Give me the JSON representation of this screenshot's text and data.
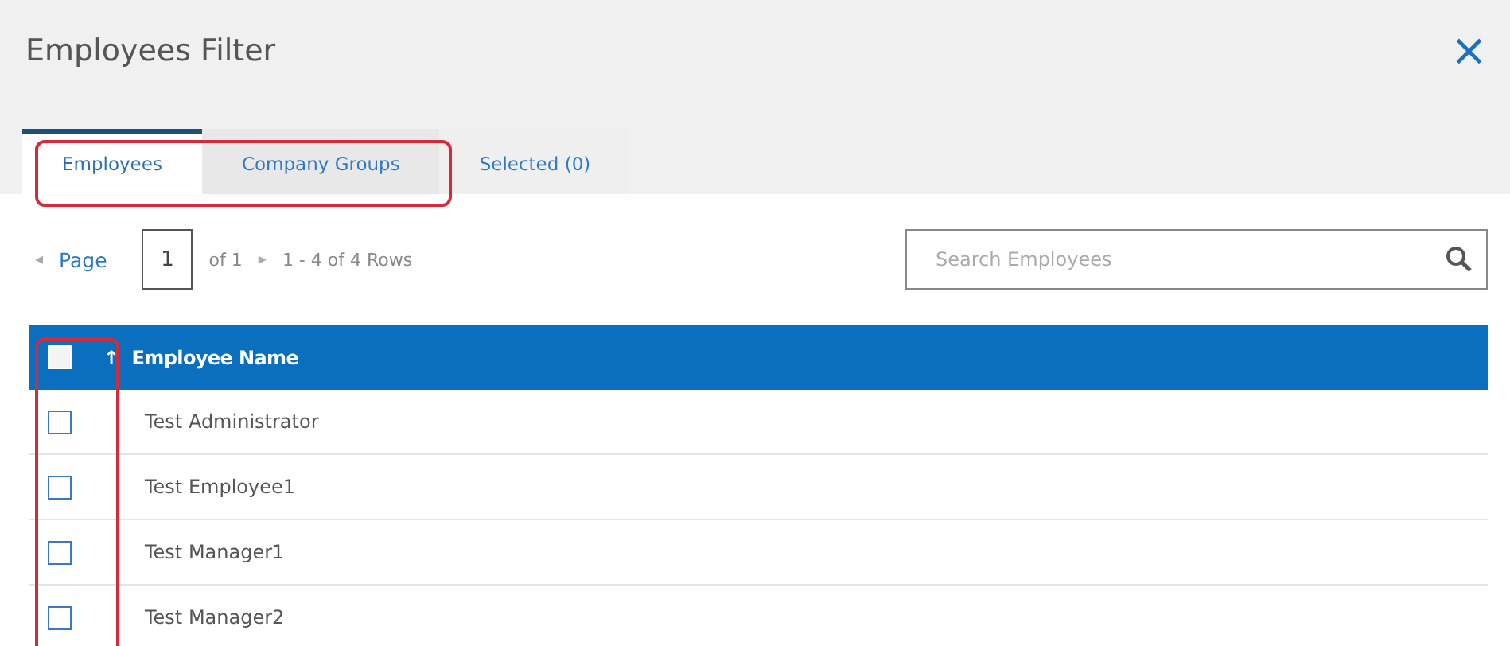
{
  "window": {
    "title": "Employees Filter",
    "close": "×"
  },
  "tabs": [
    {
      "label": "Employees",
      "selected": true,
      "highlighted": true
    },
    {
      "label": "Company Groups",
      "selected": false,
      "highlighted": true
    },
    {
      "label": "Selected (0)",
      "selected": false,
      "highlighted": false
    }
  ],
  "pager": {
    "prev": "◂",
    "label": "Page",
    "page": "1",
    "of": "of 1",
    "next": "▸",
    "rows": "1 - 4 of 4 Rows"
  },
  "search": {
    "placeholder": "Search Employees"
  },
  "table": {
    "select_all_checked": false,
    "checkbox_column_highlighted": true,
    "sort": "↑",
    "columns": [
      "Employee Name"
    ],
    "rows": [
      {
        "name": "Test Administrator",
        "checked": false
      },
      {
        "name": "Test Employee1",
        "checked": false
      },
      {
        "name": "Test Manager1",
        "checked": false
      },
      {
        "name": "Test Manager2",
        "checked": false
      }
    ]
  }
}
